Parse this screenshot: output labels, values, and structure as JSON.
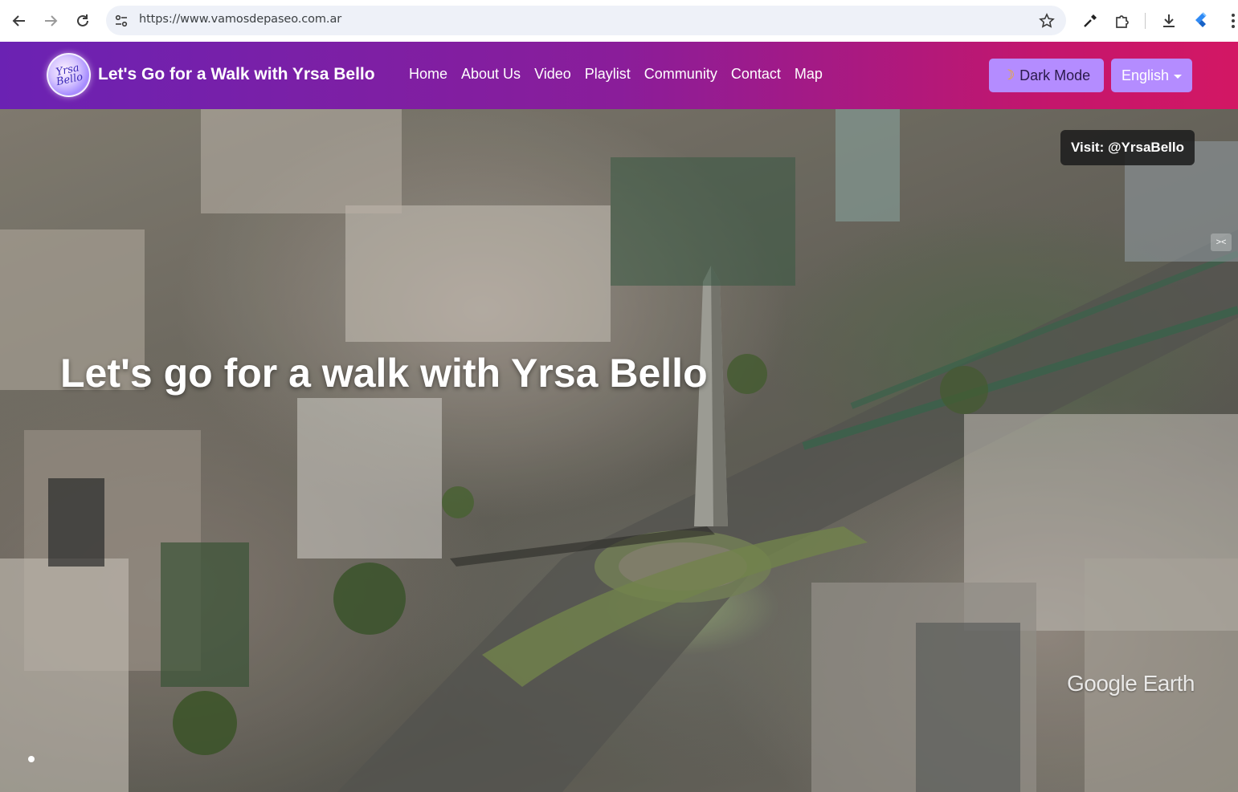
{
  "browser": {
    "url": "https://www.vamosdepaseo.com.ar",
    "icons": [
      "back-icon",
      "forward-icon",
      "reload-icon",
      "site-info-icon",
      "bookmark-star-icon",
      "eyedropper-icon",
      "extensions-icon",
      "download-icon",
      "extension-app-icon",
      "kebab-menu-icon"
    ]
  },
  "navbar": {
    "logo_text": "Yrsa Bello",
    "brand_title": "Let's Go for a Walk with Yrsa Bello",
    "links": [
      {
        "label": "Home"
      },
      {
        "label": "About Us"
      },
      {
        "label": "Video"
      },
      {
        "label": "Playlist"
      },
      {
        "label": "Community"
      },
      {
        "label": "Contact"
      },
      {
        "label": "Map"
      }
    ],
    "dark_mode_label": "Dark Mode",
    "language_label": "English",
    "colors": {
      "gradient_start": "#6b22b3",
      "gradient_end": "#d31764",
      "button": "#b48cff"
    }
  },
  "hero": {
    "title": "Let's go for a walk with Yrsa Bello",
    "visit_badge": "Visit: @YrsaBello",
    "watermark": "Google Earth",
    "slide_count": 1,
    "active_slide": 1
  }
}
